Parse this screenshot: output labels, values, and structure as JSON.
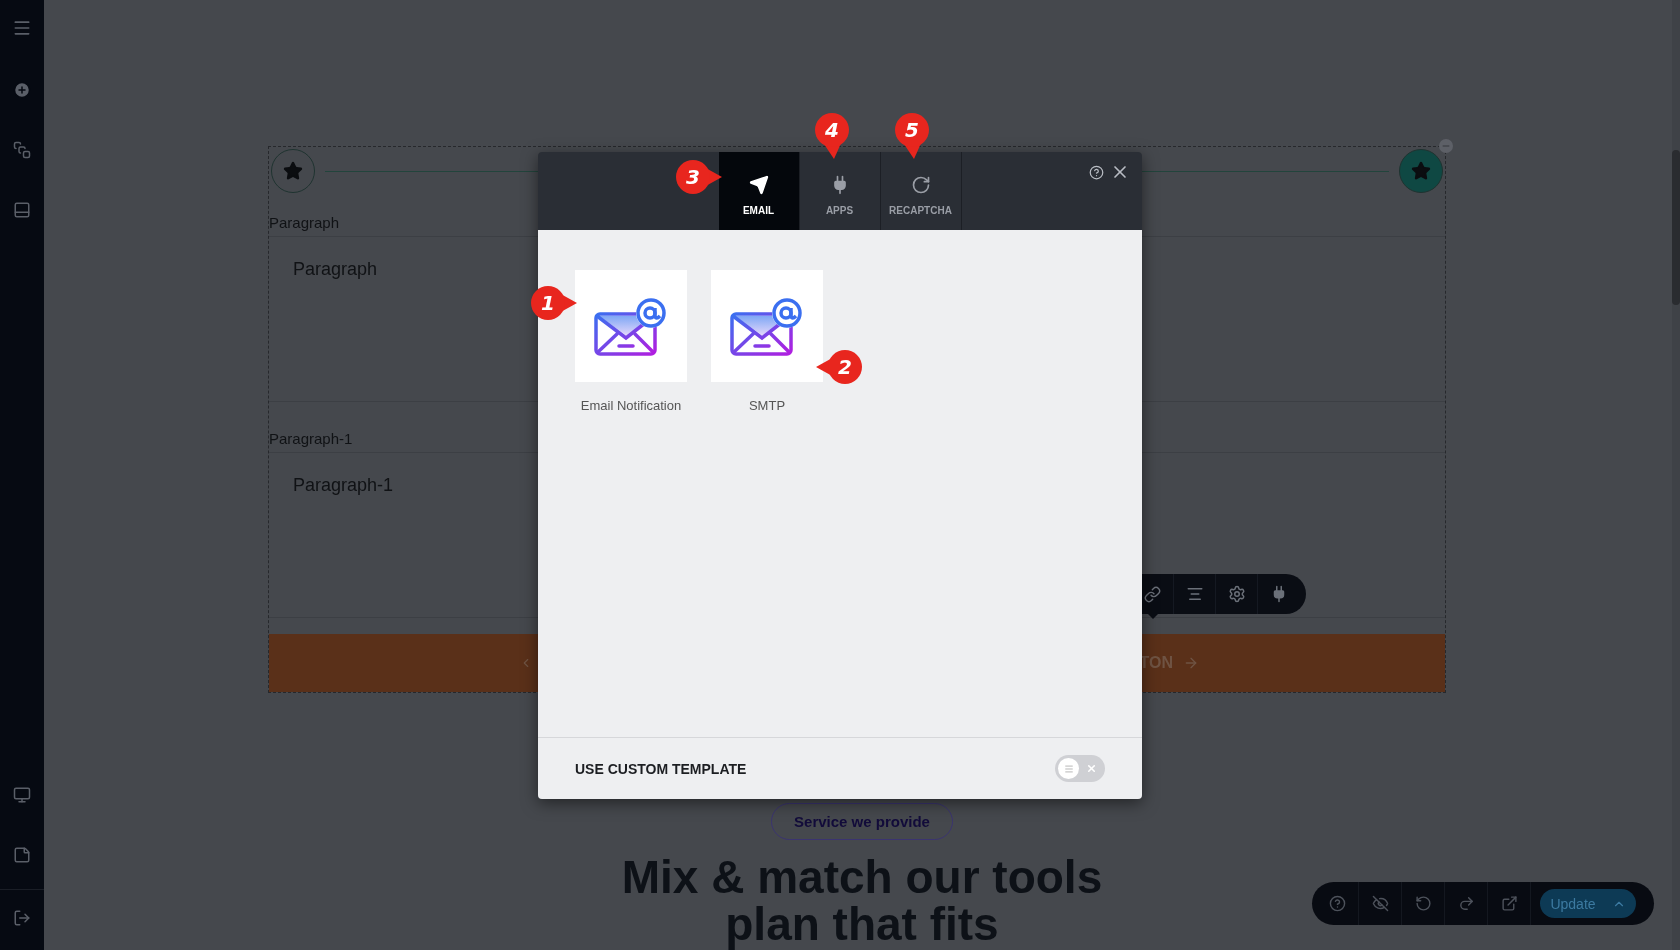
{
  "section": {
    "fields": [
      {
        "label": "Paragraph",
        "placeholder": "Paragraph"
      },
      {
        "label": "Paragraph-1",
        "placeholder": "Paragraph-1"
      }
    ],
    "button_text": "TON"
  },
  "service_pill": "Service we provide",
  "heading_lines": [
    "Mix & match our tools",
    "plan that fits"
  ],
  "modal": {
    "tabs": [
      {
        "label": "EMAIL",
        "selected": true
      },
      {
        "label": "APPS",
        "selected": false
      },
      {
        "label": "RECAPTCHA",
        "selected": false
      }
    ],
    "items": [
      {
        "label": "Email Notification"
      },
      {
        "label": "SMTP"
      }
    ],
    "footer": {
      "label": "USE CUSTOM TEMPLATE",
      "on": false
    }
  },
  "callouts": [
    {
      "number": "1"
    },
    {
      "number": "2"
    },
    {
      "number": "3"
    },
    {
      "number": "4"
    },
    {
      "number": "5"
    }
  ],
  "editor_bar": {
    "button": "Update"
  }
}
